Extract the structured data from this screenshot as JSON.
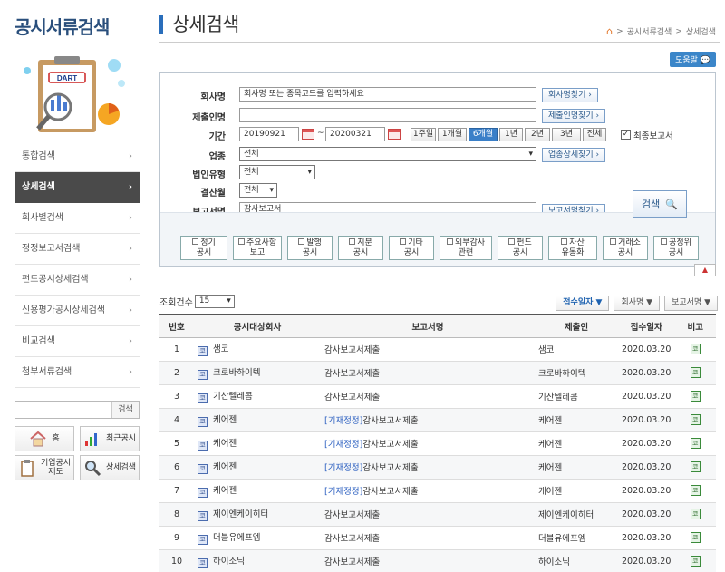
{
  "sidebar": {
    "title": "공시서류검색",
    "illustration_logo": "DART",
    "items": [
      {
        "label": "통합검색",
        "active": false
      },
      {
        "label": "상세검색",
        "active": true
      },
      {
        "label": "회사별검색",
        "active": false
      },
      {
        "label": "정정보고서검색",
        "active": false
      },
      {
        "label": "펀드공시상세검색",
        "active": false
      },
      {
        "label": "신용평가공시상세검색",
        "active": false
      },
      {
        "label": "비교검색",
        "active": false
      },
      {
        "label": "첨부서류검색",
        "active": false
      }
    ],
    "chevron": "›",
    "search_value": "",
    "search_button": "검색",
    "quick": [
      {
        "label": "홈",
        "icon": "home-icon"
      },
      {
        "label": "최근공시",
        "icon": "bar-chart-icon"
      },
      {
        "label": "기업공시\n제도",
        "icon": "clipboard-icon"
      },
      {
        "label": "상세검색",
        "icon": "magnifier-icon"
      }
    ]
  },
  "main": {
    "title": "상세검색",
    "breadcrumb": [
      "공시서류검색",
      "상세검색"
    ],
    "breadcrumb_sep": ">",
    "help_label": "도움말"
  },
  "form": {
    "company_label": "회사명",
    "company_value": "회사명 또는 종목코드를 입력하세요",
    "company_find": "회사명찾기",
    "filer_label": "제출인명",
    "filer_value": "",
    "filer_find": "제출인명찾기",
    "period_label": "기간",
    "date_from": "20190921",
    "date_sep": "~",
    "date_to": "20200321",
    "periods": [
      "1주일",
      "1개월",
      "6개월",
      "1년",
      "2년",
      "3년",
      "전체"
    ],
    "period_active": "6개월",
    "final_report_label": "최종보고서",
    "final_report_checked": true,
    "industry_label": "업종",
    "industry_value": "전체",
    "industry_find": "업종상세찾기",
    "corp_type_label": "법인유형",
    "corp_type_value": "전체",
    "settlement_label": "결산월",
    "settlement_value": "전체",
    "report_label": "보고서명",
    "report_value": "감사보고서",
    "report_find": "보고서명찾기",
    "search_button": "검색",
    "categories": [
      [
        "정기",
        "공시"
      ],
      [
        "주요사항",
        "보고"
      ],
      [
        "발행",
        "공시"
      ],
      [
        "지분",
        "공시"
      ],
      [
        "기타",
        "공시"
      ],
      [
        "외부감사",
        "관련"
      ],
      [
        "펀드",
        "공시"
      ],
      [
        "자산",
        "유동화"
      ],
      [
        "거래소",
        "공시"
      ],
      [
        "공정위",
        "공시"
      ]
    ]
  },
  "results": {
    "count_label": "조회건수",
    "count_value": "15",
    "sort_options": [
      {
        "label": "접수일자 ▼",
        "active": true
      },
      {
        "label": "회사명 ▼",
        "active": false
      },
      {
        "label": "보고서명 ▼",
        "active": false
      }
    ],
    "headers": [
      "번호",
      "공시대상회사",
      "보고서명",
      "제출인",
      "접수일자",
      "비고"
    ],
    "corp_icon": "코",
    "note_icon": "코",
    "rows": [
      {
        "no": "1",
        "company": "샘코",
        "tag": "",
        "report": "감사보고서제출",
        "filer": "샘코",
        "date": "2020.03.20"
      },
      {
        "no": "2",
        "company": "크로바하이텍",
        "tag": "",
        "report": "감사보고서제출",
        "filer": "크로바하이텍",
        "date": "2020.03.20"
      },
      {
        "no": "3",
        "company": "기산텔레콤",
        "tag": "",
        "report": "감사보고서제출",
        "filer": "기산텔레콤",
        "date": "2020.03.20"
      },
      {
        "no": "4",
        "company": "케어젠",
        "tag": "[기재정정]",
        "report": "감사보고서제출",
        "filer": "케어젠",
        "date": "2020.03.20"
      },
      {
        "no": "5",
        "company": "케어젠",
        "tag": "[기재정정]",
        "report": "감사보고서제출",
        "filer": "케어젠",
        "date": "2020.03.20"
      },
      {
        "no": "6",
        "company": "케어젠",
        "tag": "[기재정정]",
        "report": "감사보고서제출",
        "filer": "케어젠",
        "date": "2020.03.20"
      },
      {
        "no": "7",
        "company": "케어젠",
        "tag": "[기재정정]",
        "report": "감사보고서제출",
        "filer": "케어젠",
        "date": "2020.03.20"
      },
      {
        "no": "8",
        "company": "제이엔케이히터",
        "tag": "",
        "report": "감사보고서제출",
        "filer": "제이엔케이히터",
        "date": "2020.03.20"
      },
      {
        "no": "9",
        "company": "더블유에프엠",
        "tag": "",
        "report": "감사보고서제출",
        "filer": "더블유에프엠",
        "date": "2020.03.20"
      },
      {
        "no": "10",
        "company": "하이소닉",
        "tag": "",
        "report": "감사보고서제출",
        "filer": "하이소닉",
        "date": "2020.03.20"
      }
    ]
  },
  "colors": {
    "accent": "#2a6ebb",
    "active_menu": "#4a4a4a",
    "tag": "#2b5fc0",
    "period_active": "#3a7fc8"
  }
}
